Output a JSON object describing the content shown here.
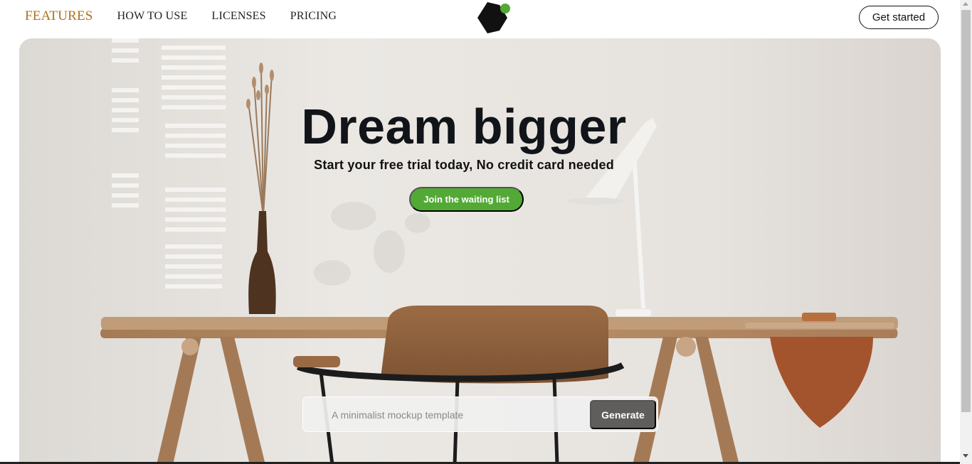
{
  "nav": {
    "items": [
      {
        "label": "FEATURES"
      },
      {
        "label": "HOW TO USE"
      },
      {
        "label": "LICENSES"
      },
      {
        "label": "PRICING"
      }
    ],
    "active_color": "#b0701e",
    "cta_label": "Get started",
    "logo_icon": "hexagon-dot-logo",
    "logo_colors": {
      "body": "#111111",
      "dot": "#52a935"
    }
  },
  "hero": {
    "title": "Dream bigger",
    "subtitle": "Start your free trial today, No credit card needed",
    "join_label": "Join the waiting list",
    "join_color": "#52a935",
    "generator": {
      "placeholder": "A minimalist mockup template",
      "value": "",
      "button_label": "Generate"
    }
  }
}
